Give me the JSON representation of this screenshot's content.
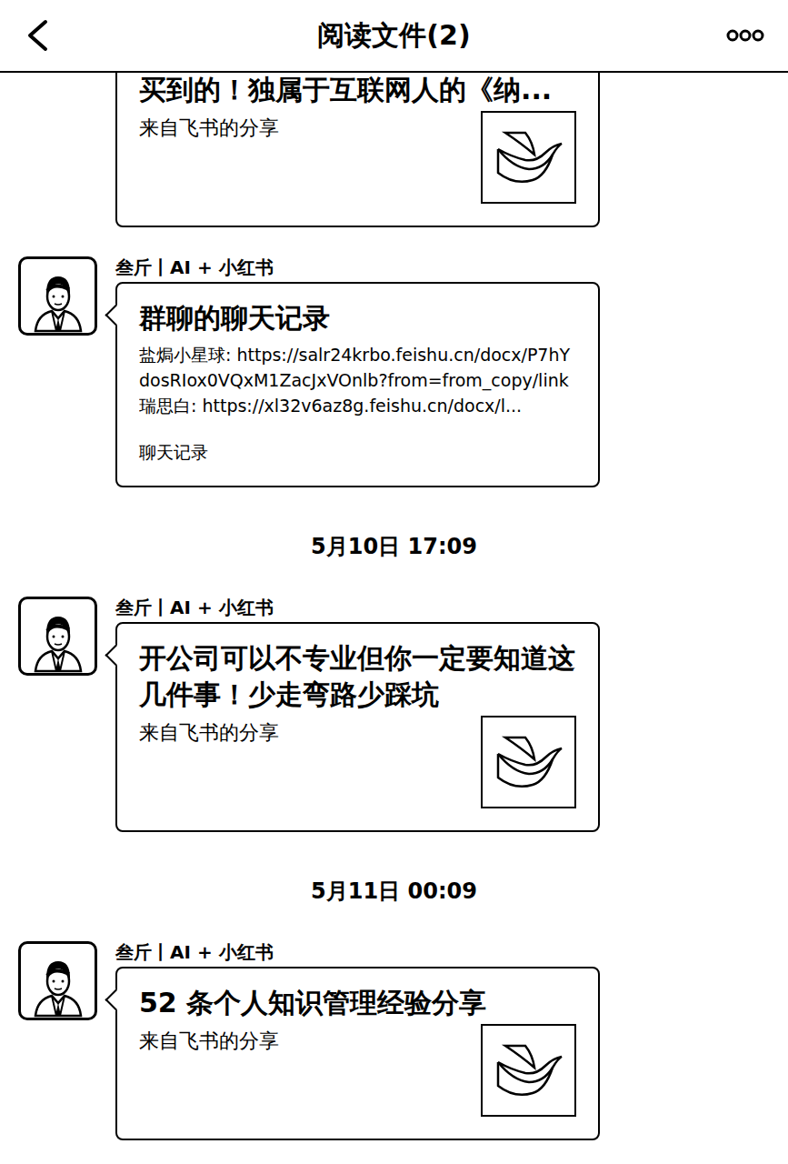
{
  "header": {
    "title": "阅读文件(2)"
  },
  "items": [
    {
      "kind": "share",
      "title": "买到的！独属于互联网人的《纳...",
      "source": "来自飞书的分享"
    },
    {
      "kind": "record",
      "sender": "叁斤丨AI + 小红书",
      "title": "群聊的聊天记录",
      "lines": [
        "盐焗小星球: https://salr24krbo.feishu.cn/docx/P7hYdosRIox0VQxM1ZacJxVOnlb?from=from_copy/link",
        "瑞思白: https://xl32v6az8g.feishu.cn/docx/l..."
      ],
      "footer": "聊天记录"
    },
    {
      "kind": "time",
      "text": "5月10日 17:09"
    },
    {
      "kind": "share",
      "sender": "叁斤丨AI + 小红书",
      "title": "开公司可以不专业但你一定要知道这几件事！少走弯路少踩坑",
      "source": "来自飞书的分享"
    },
    {
      "kind": "time",
      "text": "5月11日 00:09"
    },
    {
      "kind": "share",
      "sender": "叁斤丨AI + 小红书",
      "title": "52 条个人知识管理经验分享",
      "source": "来自飞书的分享"
    }
  ]
}
